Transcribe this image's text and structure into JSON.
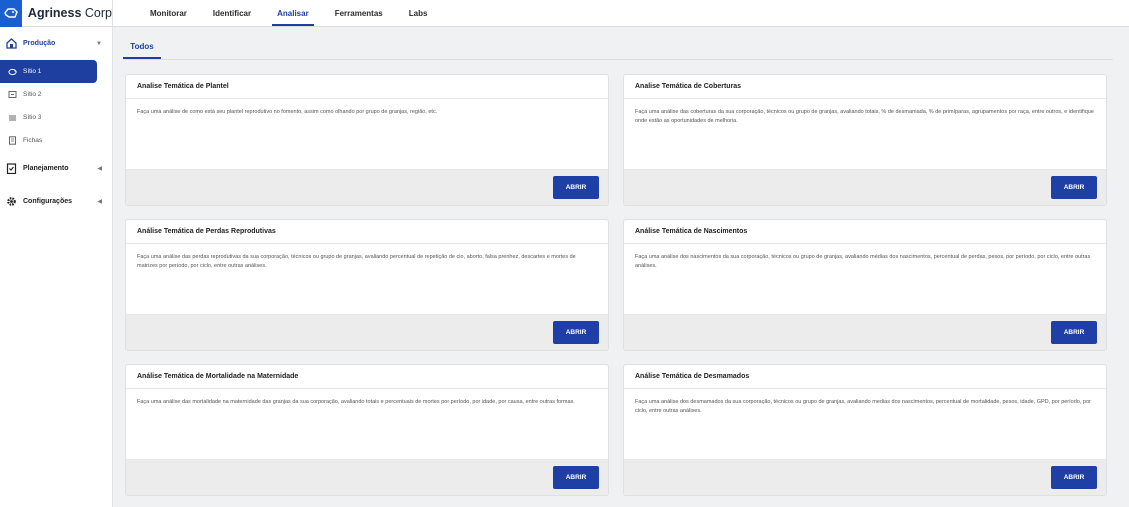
{
  "app": {
    "brand_bold": "Agriness",
    "brand_light": " Corp"
  },
  "topnav": [
    {
      "label": "Monitorar",
      "active": false
    },
    {
      "label": "Identificar",
      "active": false
    },
    {
      "label": "Analisar",
      "active": true
    },
    {
      "label": "Ferramentas",
      "active": false
    },
    {
      "label": "Labs",
      "active": false
    }
  ],
  "sidebar": {
    "producao": "Produção",
    "items": [
      {
        "label": "Sítio 1",
        "active": true
      },
      {
        "label": "Sítio 2",
        "active": false
      },
      {
        "label": "Sítio 3",
        "active": false
      },
      {
        "label": "Fichas",
        "active": false
      }
    ],
    "planejamento": "Planejamento",
    "configuracoes": "Configurações"
  },
  "main": {
    "tab": "Todos",
    "button_label": "ABRIR",
    "cards": [
      {
        "title": "Analise Temática de Plantel",
        "text": "Faça uma análise de como está seu plantel reprodutivo no fomento, assim como olhando por grupo de granjas, região, etc."
      },
      {
        "title": "Analise Temática de Coberturas",
        "text": "Faça uma análise das coberturas da sua corporação, técnicos ou grupo de granjas, avaliando totais, % de desmamada, % de primíparas, agrupamentos por raça, entre outros, e identifique onde estão as oportunidades de melhoria."
      },
      {
        "title": "Análise Temática de Perdas Reprodutivas",
        "text": "Faça uma análise das perdas reprodutivas da sua corporação, técnicos ou grupo de granjas, avaliando percentual de repetição de cio, aborto, falsa prenhez, descartes e mortes de matrizes por período, por ciclo, entre outras análises."
      },
      {
        "title": "Análise Temática de Nascimentos",
        "text": "Faça uma análise dos nascimentos da sua corporação, técnicos ou grupo de granjas, avaliando médias dos nascimentos, percentual de perdas, pesos, por período, por ciclo, entre outras análises."
      },
      {
        "title": "Análise Temática de Mortalidade na Maternidade",
        "text": "Faça uma análise das mortalidade na maternidade das granjas da sua corporação, avaliando totais e percentuais de mortes por período, por idade, por causa, entre outras formas."
      },
      {
        "title": "Análise Temática de Desmamados",
        "text": "Faça uma análise dos desmamados da sua corporação, técnicos ou grupo de granjas, avaliando medias dos nascimentos, percentual de mortalidade, pesos, idade, GPD, por período, por ciclo, entre outras análises."
      }
    ]
  },
  "colors": {
    "accent": "#1e3fa0",
    "button": "#1d3fa6",
    "logo": "#1a5fd1"
  }
}
